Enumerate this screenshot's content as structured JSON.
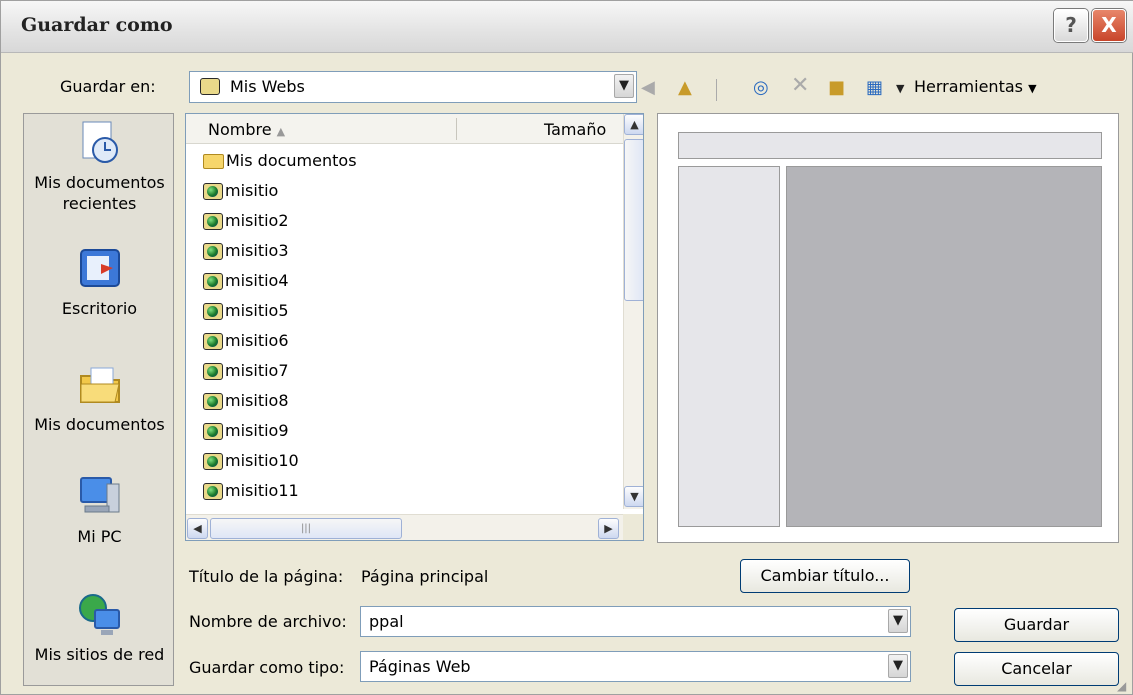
{
  "window": {
    "title": "Guardar como",
    "help_label": "?",
    "close_label": "X"
  },
  "location": {
    "label": "Guardar en:",
    "value": "Mis Webs"
  },
  "toolbar": {
    "tools_label": "Herramientas",
    "icons": [
      "back-icon",
      "up-folder-icon",
      "search-web-icon",
      "delete-icon",
      "new-folder-icon",
      "views-icon"
    ]
  },
  "places": [
    {
      "label_line1": "Mis documentos",
      "label_line2": "recientes",
      "icon": "recent-documents-icon"
    },
    {
      "label_line1": "Escritorio",
      "label_line2": "",
      "icon": "desktop-icon"
    },
    {
      "label_line1": "Mis documentos",
      "label_line2": "",
      "icon": "my-documents-icon"
    },
    {
      "label_line1": "Mi PC",
      "label_line2": "",
      "icon": "my-computer-icon"
    },
    {
      "label_line1": "Mis sitios de red",
      "label_line2": "",
      "icon": "network-places-icon"
    }
  ],
  "filelist": {
    "col_name": "Nombre",
    "col_size": "Tamaño",
    "items": [
      {
        "name": "Mis documentos",
        "type": "folder"
      },
      {
        "name": "misitio",
        "type": "web"
      },
      {
        "name": "misitio2",
        "type": "web"
      },
      {
        "name": "misitio3",
        "type": "web"
      },
      {
        "name": "misitio4",
        "type": "web"
      },
      {
        "name": "misitio5",
        "type": "web"
      },
      {
        "name": "misitio6",
        "type": "web"
      },
      {
        "name": "misitio7",
        "type": "web"
      },
      {
        "name": "misitio8",
        "type": "web"
      },
      {
        "name": "misitio9",
        "type": "web"
      },
      {
        "name": "misitio10",
        "type": "web"
      },
      {
        "name": "misitio11",
        "type": "web"
      }
    ]
  },
  "page_title": {
    "label": "Título de la página:",
    "value": "Página principal",
    "change_button": "Cambiar título..."
  },
  "filename": {
    "label": "Nombre de archivo:",
    "value": "ppal"
  },
  "filetype": {
    "label": "Guardar como tipo:",
    "value": "Páginas Web"
  },
  "actions": {
    "save": "Guardar",
    "cancel": "Cancelar"
  }
}
